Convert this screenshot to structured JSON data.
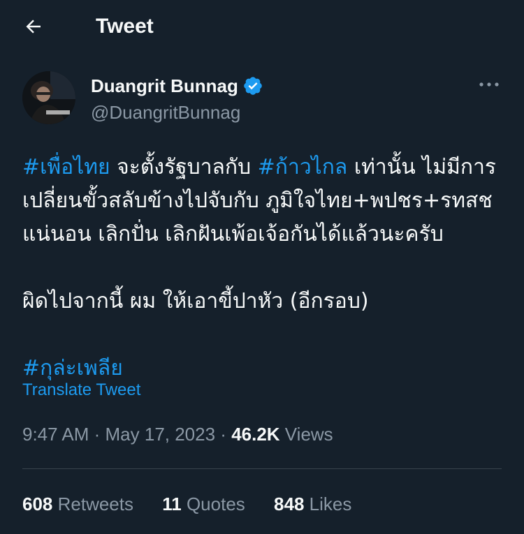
{
  "header": {
    "back_icon": "arrow-left-icon",
    "title": "Tweet"
  },
  "author": {
    "display_name": "Duangrit Bunnag",
    "verified_icon": "verified-badge-icon",
    "handle": "@DuangritBunnag",
    "more_icon": "more-horizontal-icon"
  },
  "tweet": {
    "line1": {
      "tag1": "#เพื่อไทย",
      "text1": " จะตั้งรัฐบาลกับ ",
      "tag2": "#ก้าวไกล",
      "text2": " เท่านั้น ไม่มีการ"
    },
    "line2": "เปลี่ยนขั้วสลับข้างไปจับกับ ภูมิใจไทย+พปชร+รทสช",
    "line3": "แน่นอน เลิกปั่น เลิกฝันเพ้อเจ้อกันได้แล้วนะครับ",
    "line4": "ผิดไปจากนี้ ผม ให้เอาขี้ปาหัว (อีกรอบ)",
    "tag3": "#กุล่ะเพลีย",
    "translate_label": "Translate Tweet"
  },
  "meta": {
    "time": "9:47 AM",
    "sep1": " · ",
    "date": "May 17, 2023",
    "sep2": " · ",
    "views_count": "46.2K",
    "views_label": " Views"
  },
  "stats": {
    "retweets_count": "608",
    "retweets_label": " Retweets",
    "quotes_count": "11",
    "quotes_label": " Quotes",
    "likes_count": "848",
    "likes_label": " Likes"
  },
  "colors": {
    "background": "#15202b",
    "accent": "#1d9bf0",
    "text_primary": "#f7f9f9",
    "text_secondary": "#8b98a5",
    "divider": "#38444d"
  }
}
